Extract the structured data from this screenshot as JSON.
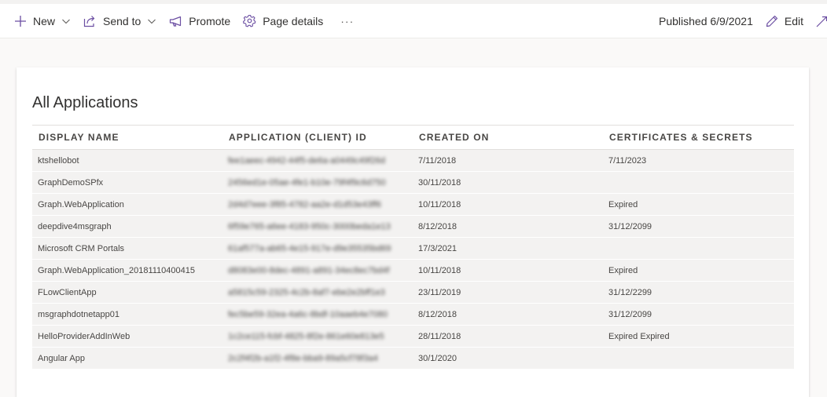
{
  "commandbar": {
    "new_label": "New",
    "send_to_label": "Send to",
    "promote_label": "Promote",
    "page_details_label": "Page details",
    "more_label": "···",
    "published_text": "Published 6/9/2021",
    "edit_label": "Edit"
  },
  "section": {
    "title": "All Applications"
  },
  "table": {
    "headers": [
      "DISPLAY NAME",
      "APPLICATION (CLIENT) ID",
      "CREATED ON",
      "CERTIFICATES & SECRETS"
    ],
    "rows": [
      {
        "name": "ktshellobot",
        "client_id": "fee1aeec-4942-44f5-de6a-a0449c49f26d",
        "created": "7/11/2018",
        "secrets": "7/11/2023"
      },
      {
        "name": "GraphDemoSPfx",
        "client_id": "2456ed1e-05ae-4fe1-b10e-79f4f9c6d750",
        "created": "30/11/2018",
        "secrets": ""
      },
      {
        "name": "Graph.WebApplication",
        "client_id": "2d4d7eee-3f85-4782-aa2e-d1d53e43ff6",
        "created": "10/11/2018",
        "secrets": "Expired"
      },
      {
        "name": "deepdive4msgraph",
        "client_id": "6f59e765-a6ee-4183-950c-3000beda1e13",
        "created": "8/12/2018",
        "secrets": "31/12/2099"
      },
      {
        "name": "Microsoft CRM Portals",
        "client_id": "61af577a-ab65-4e15-917e-d9e35535bd69",
        "created": "17/3/2021",
        "secrets": ""
      },
      {
        "name": "Graph.WebApplication_20181110400415",
        "client_id": "d8083e00-8dec-4891-a891-34ec8ec7bd4f",
        "created": "10/11/2018",
        "secrets": "Expired"
      },
      {
        "name": "FLowClientApp",
        "client_id": "a5815c59-2325-4c2b-8af7-ebe2e2bff1e3",
        "created": "23/11/2019",
        "secrets": "31/12/2299"
      },
      {
        "name": "msgraphdotnetapp01",
        "client_id": "fec5be59-32ea-4a6c-8bdf-10aaeb4e7080",
        "created": "8/12/2018",
        "secrets": "31/12/2099"
      },
      {
        "name": "HelloProviderAddInWeb",
        "client_id": "1c2ce115-fcbf-4825-8f2e-861e60e813e5",
        "created": "28/11/2018",
        "secrets": "Expired Expired"
      },
      {
        "name": "Angular App",
        "client_id": "2c2f4f2b-a1f2-4f8e-bba9-89a5cf78f3a4",
        "created": "30/1/2020",
        "secrets": ""
      }
    ]
  },
  "icons": {
    "new": "plus-icon",
    "send_to": "share-icon",
    "promote": "megaphone-icon",
    "page_details": "gear-icon",
    "edit": "pencil-icon",
    "expand": "expand-icon"
  },
  "colors": {
    "accent": "#6b4ea2",
    "row_background": "#f3f2f1"
  }
}
